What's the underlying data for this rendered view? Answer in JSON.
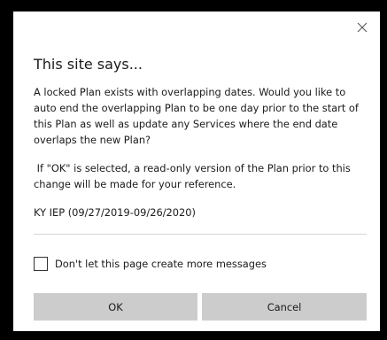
{
  "dialog": {
    "title": "This site says...",
    "message_paragraph_1": "A locked Plan exists with overlapping dates. Would you like to auto end the overlapping Plan to be one day prior to the start of this Plan as well as update any Services where the end date overlaps the new Plan?",
    "message_paragraph_2": " If \"OK\" is selected, a read-only version of the Plan prior to this change will be made for your reference.",
    "message_paragraph_3": "KY IEP (09/27/2019-09/26/2020)",
    "checkbox_label": "Don't let this page create more messages",
    "checkbox_checked": false,
    "ok_label": "OK",
    "cancel_label": "Cancel",
    "close_icon": "close-icon"
  },
  "colors": {
    "backdrop": "#000000",
    "dialog_background": "#ffffff",
    "button_background": "#cccccc",
    "text": "#1a1a1a"
  }
}
